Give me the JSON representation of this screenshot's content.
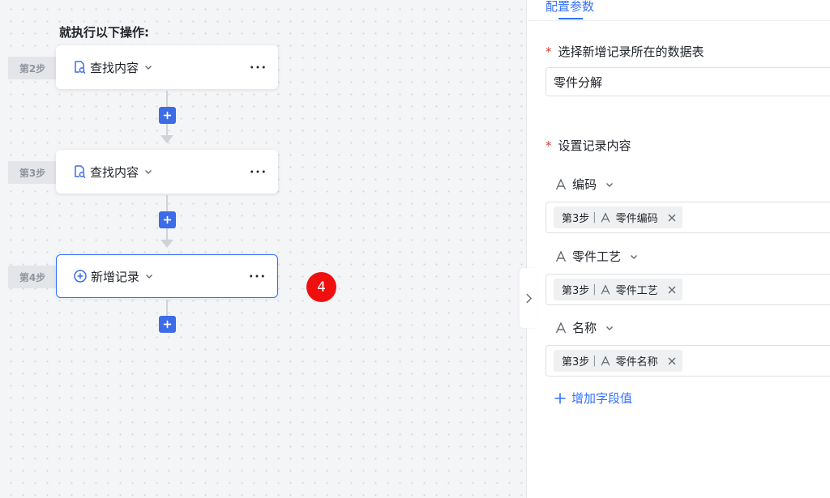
{
  "canvas": {
    "title": "就执行以下操作:",
    "steps": [
      {
        "tag": "第2步",
        "label": "查找内容",
        "icon": "search-record-icon",
        "selected": false
      },
      {
        "tag": "第3步",
        "label": "查找内容",
        "icon": "search-record-icon",
        "selected": false
      },
      {
        "tag": "第4步",
        "label": "新增记录",
        "icon": "add-circle-icon",
        "selected": true
      }
    ],
    "badge": "4"
  },
  "panel": {
    "tab": "配置参数",
    "table_field": {
      "label": "选择新增记录所在的数据表",
      "value": "零件分解"
    },
    "content_label": "设置记录内容",
    "fields": [
      {
        "name": "编码",
        "token_step": "第3步",
        "token_sep": "|",
        "token_value": "零件编码"
      },
      {
        "name": "零件工艺",
        "token_step": "第3步",
        "token_sep": "|",
        "token_value": "零件工艺"
      },
      {
        "name": "名称",
        "token_step": "第3步",
        "token_sep": "|",
        "token_value": "零件名称"
      }
    ],
    "add_field": "增加字段值",
    "required_mark": "*"
  },
  "colors": {
    "accent": "#3370ff",
    "add_button": "#3d6ce8",
    "badge": "#f00f0f",
    "required": "#d83931"
  }
}
